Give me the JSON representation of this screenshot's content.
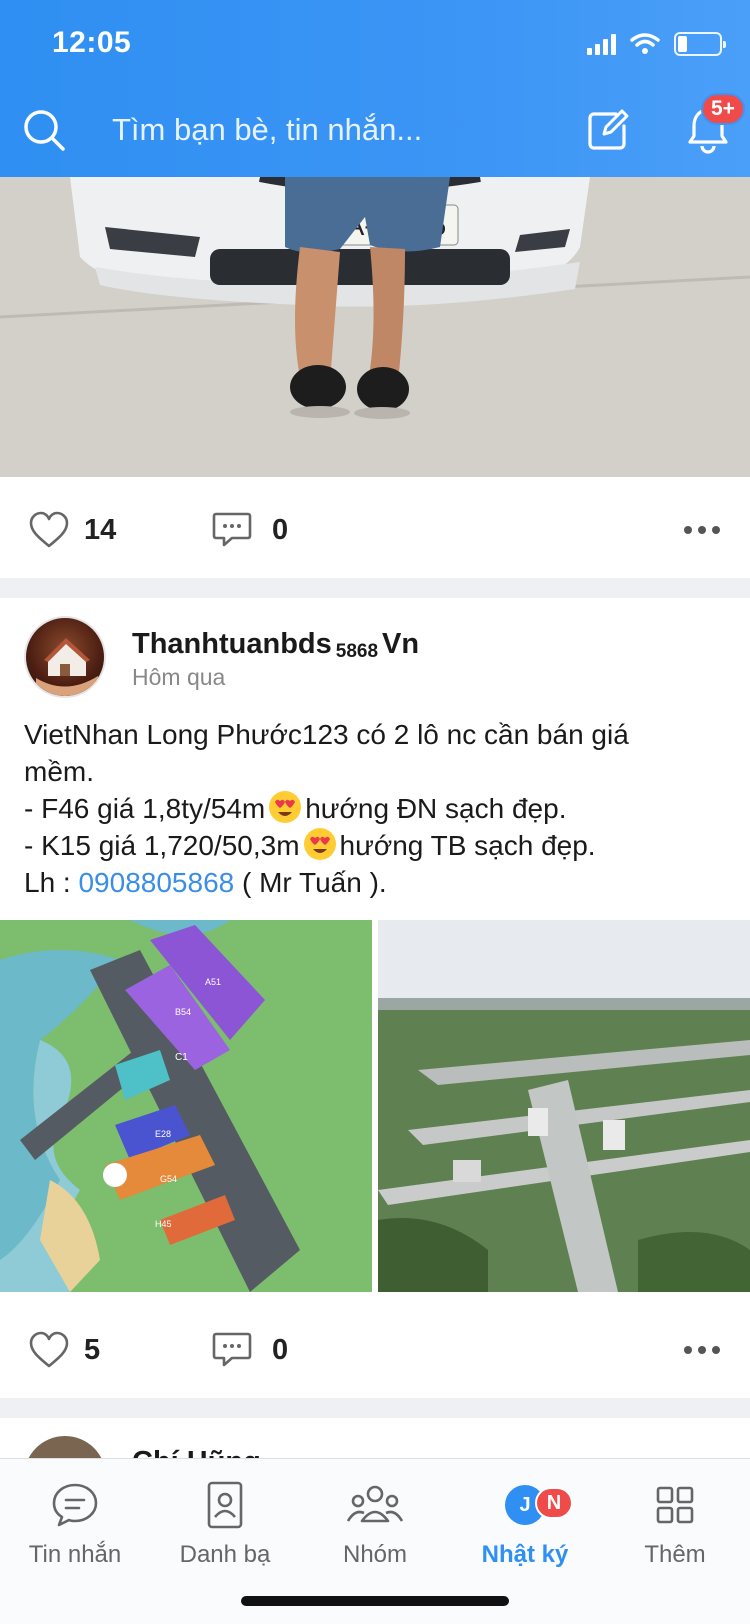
{
  "status_bar": {
    "time": "12:05"
  },
  "header": {
    "search_placeholder": "Tìm bạn bè, tin nhắn...",
    "notification_badge": "5+"
  },
  "post1": {
    "likes": "14",
    "comments": "0"
  },
  "post2": {
    "author": "Thanhtuanbds",
    "author_sub": "5868",
    "author_suffix": "Vn",
    "time": "Hôm qua",
    "text_line1": "VietNhan Long Phước123 có 2 lô nc cần bán giá",
    "text_line2": "mềm.",
    "text_line3a": "- F46 giá 1,8ty/54m",
    "text_line3b": "hướng ĐN sạch đẹp.",
    "text_line4a": "- K15 giá 1,720/50,3m",
    "text_line4b": "hướng TB sạch đẹp.",
    "text_line5a": "Lh : ",
    "phone": "0908805868",
    "text_line5b": " ( Mr Tuấn ).",
    "likes": "5",
    "comments": "0"
  },
  "post3_peek": {
    "author": "Chí Hũng"
  },
  "bottom_nav": {
    "items": [
      {
        "label": "Tin nhắn",
        "icon": "chat-icon"
      },
      {
        "label": "Danh bạ",
        "icon": "contacts-icon"
      },
      {
        "label": "Nhóm",
        "icon": "group-icon"
      },
      {
        "label": "Nhật ký",
        "icon": "timeline-icon",
        "active": true,
        "badge": "N",
        "avatar_initial": "J"
      },
      {
        "label": "Thêm",
        "icon": "grid-icon"
      }
    ]
  },
  "colors": {
    "accent": "#2f8ff2",
    "badge": "#f04b4b",
    "link": "#3a8ee6"
  }
}
